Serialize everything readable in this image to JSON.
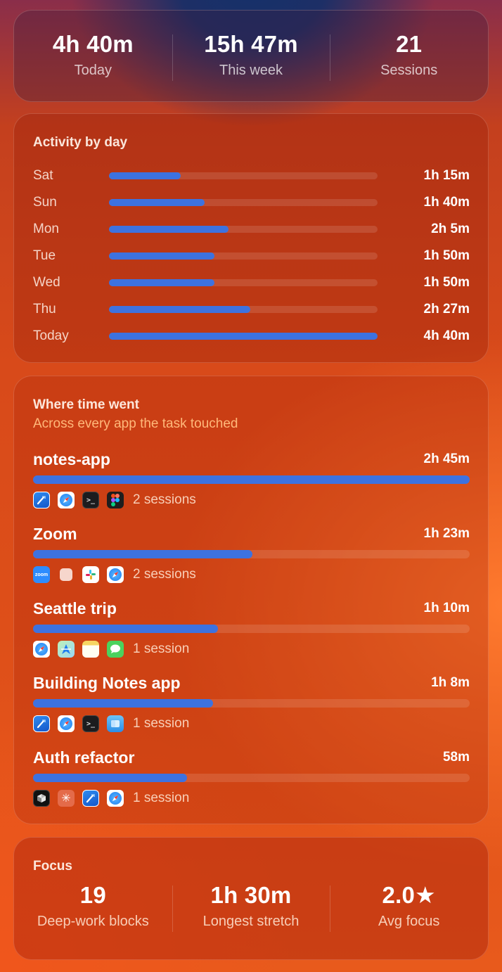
{
  "summary": {
    "stats": [
      {
        "value": "4h 40m",
        "label": "Today"
      },
      {
        "value": "15h 47m",
        "label": "This week"
      },
      {
        "value": "21",
        "label": "Sessions"
      }
    ]
  },
  "activity": {
    "title": "Activity by day",
    "days": [
      {
        "label": "Sat",
        "value": "1h 15m",
        "fraction": 0.268
      },
      {
        "label": "Sun",
        "value": "1h 40m",
        "fraction": 0.357
      },
      {
        "label": "Mon",
        "value": "2h 5m",
        "fraction": 0.446
      },
      {
        "label": "Tue",
        "value": "1h 50m",
        "fraction": 0.393
      },
      {
        "label": "Wed",
        "value": "1h 50m",
        "fraction": 0.393
      },
      {
        "label": "Thu",
        "value": "2h 27m",
        "fraction": 0.525
      },
      {
        "label": "Today",
        "value": "4h 40m",
        "fraction": 1.0
      }
    ]
  },
  "where": {
    "title": "Where time went",
    "subtitle": "Across every app the task touched",
    "projects": [
      {
        "name": "notes-app",
        "time": "2h 45m",
        "fraction": 1.0,
        "sessions": "2 sessions",
        "icons": [
          "xcode-icon",
          "safari-icon",
          "terminal-icon",
          "figma-icon"
        ]
      },
      {
        "name": "Zoom",
        "time": "1h 23m",
        "fraction": 0.503,
        "sessions": "2 sessions",
        "icons": [
          "zoom-icon",
          "blank-app-icon",
          "slack-icon",
          "safari-icon"
        ]
      },
      {
        "name": "Seattle trip",
        "time": "1h 10m",
        "fraction": 0.424,
        "sessions": "1 session",
        "icons": [
          "safari-icon",
          "maps-icon",
          "notes-icon",
          "messages-icon"
        ]
      },
      {
        "name": "Building Notes app",
        "time": "1h 8m",
        "fraction": 0.412,
        "sessions": "1 session",
        "icons": [
          "xcode-icon",
          "safari-icon",
          "terminal-icon",
          "finder-icon"
        ]
      },
      {
        "name": "Auth refactor",
        "time": "58m",
        "fraction": 0.352,
        "sessions": "1 session",
        "icons": [
          "cursor-icon",
          "claude-icon",
          "xcode-icon",
          "safari-icon"
        ]
      }
    ]
  },
  "focus": {
    "title": "Focus",
    "stats": [
      {
        "value": "19",
        "label": "Deep-work blocks"
      },
      {
        "value": "1h 30m",
        "label": "Longest stretch"
      },
      {
        "value": "2.0★",
        "label": "Avg focus"
      }
    ]
  },
  "colors": {
    "bar_fill": "#3d72e0",
    "subtitle": "#ffb87a"
  }
}
